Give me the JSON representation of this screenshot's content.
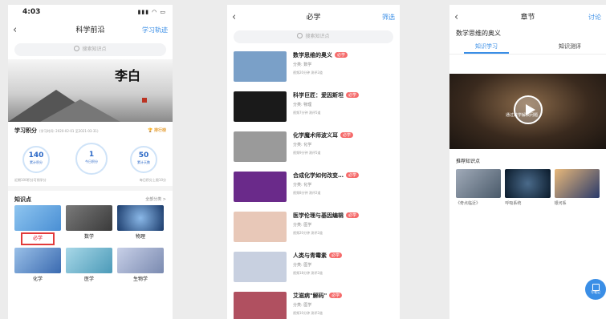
{
  "phone1": {
    "status": {
      "time": "4:03"
    },
    "nav": {
      "title": "科学前沿",
      "right": "学习轨迹"
    },
    "search_placeholder": "搜索知识点",
    "banner_title": "李白",
    "score": {
      "title": "学习积分",
      "subtitle": "(学习时间: 2020-02-01 至2021-03-31)",
      "rank_label": "排行榜",
      "circles": [
        {
          "value": "140",
          "label": "累计积分"
        },
        {
          "value": "1",
          "label": "今日积分"
        },
        {
          "value": "50",
          "label": "累计天数"
        }
      ],
      "note_left": "近期100积分可领学分",
      "note_right": "每日积分上限10分"
    },
    "knowledge": {
      "title": "知识点",
      "all_label": "全部分类 >",
      "tiles": [
        {
          "label": "必学",
          "color": "#4a8fd4"
        },
        {
          "label": "数学",
          "color": "#5a5a5a"
        },
        {
          "label": "物理",
          "color": "#3a5a8a"
        },
        {
          "label": "化学",
          "color": "#3a6ab0"
        },
        {
          "label": "医学",
          "color": "#4b9ab8"
        },
        {
          "label": "生物学",
          "color": "#7a8ab0"
        }
      ]
    }
  },
  "phone2": {
    "nav": {
      "title": "必学",
      "right": "筛选"
    },
    "search_placeholder": "搜索知识点",
    "tag_label": "必学",
    "items": [
      {
        "title": "数学思维的奥义",
        "category": "分类: 数学",
        "detail": "视频20分钟 测评2道",
        "color": "#7aa0c8"
      },
      {
        "title": "科学巨匠：爱因斯坦",
        "category": "分类: 物理",
        "detail": "视频7分钟 测评5道",
        "color": "#1a1a1a"
      },
      {
        "title": "化学魔术师波义耳",
        "category": "分类: 化学",
        "detail": "视频9分钟 测评5道",
        "color": "#9a9a9a"
      },
      {
        "title": "合成化学如何改变…",
        "category": "分类: 化学",
        "detail": "视频8分钟 测评2道",
        "color": "#6a2a8a"
      },
      {
        "title": "医学伦理与基因编辑",
        "category": "分类: 医学",
        "detail": "视频20分钟 测评2道",
        "color": "#e8c8b8"
      },
      {
        "title": "人类与青霉素",
        "category": "分类: 医学",
        "detail": "视频18分钟 测评2道",
        "color": "#c8d0e0"
      },
      {
        "title": "艾滋病\"解码\"",
        "category": "分类: 医学",
        "detail": "视频10分钟 测评2道",
        "color": "#b05060"
      }
    ]
  },
  "phone3": {
    "nav": {
      "title": "章节",
      "right": "讨论"
    },
    "course_title": "数学思维的奥义",
    "tabs": [
      "知识学习",
      "知识测评"
    ],
    "video_caption": "通过数学解决问题",
    "rec_title": "推荐知识点",
    "rec_items": [
      {
        "label": "《奇点临近》",
        "color": "#7a8a9a"
      },
      {
        "label": "呼吸系统",
        "color": "#1a2a3a"
      },
      {
        "label": "银河系",
        "color": "#2a3a6a"
      }
    ],
    "fab_label": "写笔记"
  }
}
